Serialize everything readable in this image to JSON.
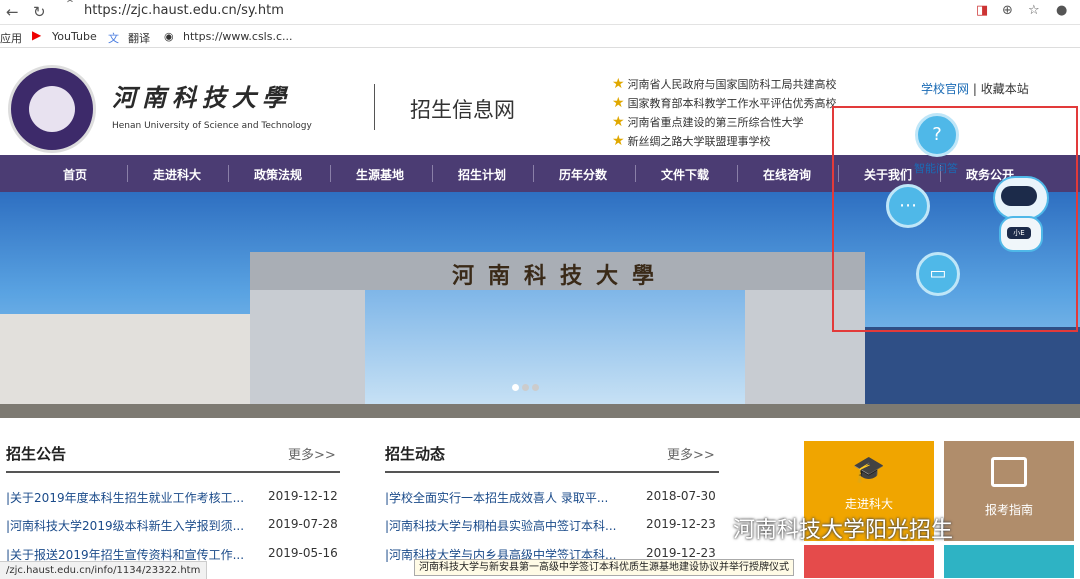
{
  "browser": {
    "url": "https://zjc.haust.edu.cn/sy.htm",
    "bookmarks": [
      "应用",
      "YouTube",
      "翻译",
      "https://www.csls.c..."
    ]
  },
  "header": {
    "university_cn": "河南科技大學",
    "university_en": "Henan University of Science and Technology",
    "site_title": "招生信息网",
    "badges": [
      "河南省人民政府与国家国防科工局共建高校",
      "国家教育部本科教学工作水平评估优秀高校",
      "河南省重点建设的第三所综合性大学",
      "新丝绸之路大学联盟理事学校"
    ],
    "link_official": "学校官网",
    "link_separator": "|",
    "link_bookmark": "收藏本站"
  },
  "nav": [
    "首页",
    "走进科大",
    "政策法规",
    "生源基地",
    "招生计划",
    "历年分数",
    "文件下载",
    "在线咨询",
    "关于我们",
    "政务公开"
  ],
  "banner": {
    "gate_text": "河南科技大學"
  },
  "widget": {
    "qa_label": "智能问答",
    "robot_badge": "小E",
    "highlight_color": "#e23a3a"
  },
  "sections": [
    {
      "title": "招生公告",
      "more": "更多>>",
      "rows": [
        {
          "title": "|关于2019年度本科生招生就业工作考核工...",
          "date": "2019-12-12"
        },
        {
          "title": "|河南科技大学2019级本科新生入学报到须...",
          "date": "2019-07-28"
        },
        {
          "title": "|关于报送2019年招生宣传资料和宣传工作...",
          "date": "2019-05-16"
        }
      ]
    },
    {
      "title": "招生动态",
      "more": "更多>>",
      "rows": [
        {
          "title": "|学校全面实行一本招生成效喜人 录取平...",
          "date": "2018-07-30"
        },
        {
          "title": "|河南科技大学与桐柏县实验高中签订本科...",
          "date": "2019-12-23"
        },
        {
          "title": "|河南科技大学与内乡县高级中学签订本科...",
          "date": "2019-12-23"
        }
      ]
    }
  ],
  "tiles": [
    {
      "label": "走进科大",
      "color": "#f0a500"
    },
    {
      "label": "报考指南",
      "color": "#b08d6b"
    }
  ],
  "status_url": "/zjc.haust.edu.cn/info/1134/23322.htm",
  "tooltip": "河南科技大学与新安县第一高级中学签订本科优质生源基地建设协议并举行授牌仪式",
  "watermark": "河南科技大学阳光招生"
}
